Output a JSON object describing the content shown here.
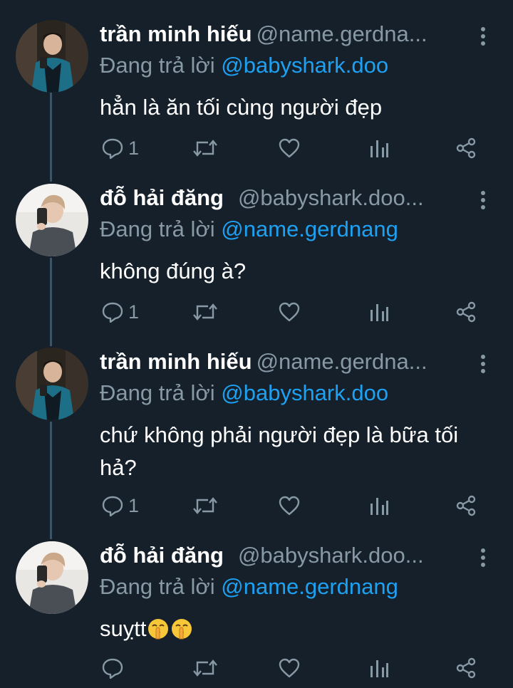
{
  "tweets": [
    {
      "name": "trần minh hiếu",
      "handle": "@name.gerdna...",
      "reply_prefix": "Đang trả lời",
      "reply_to": "@babyshark.doo",
      "text": "hẳn là ăn tối cùng người đẹp",
      "reply_count": "1",
      "avatar": "person-in-blue-jacket-avatar"
    },
    {
      "name": "đỗ hải đăng",
      "handle": "@babyshark.doo...",
      "reply_prefix": "Đang trả lời",
      "reply_to": "@name.gerdnang",
      "text": "không đúng à?",
      "reply_count": "1",
      "avatar": "mirror-selfie-avatar"
    },
    {
      "name": "trần minh hiếu",
      "handle": "@name.gerdna...",
      "reply_prefix": "Đang trả lời",
      "reply_to": "@babyshark.doo",
      "text": "chứ không phải người đẹp là bữa tối hả?",
      "reply_count": "1",
      "avatar": "person-in-blue-jacket-avatar"
    },
    {
      "name": "đỗ hải đăng",
      "handle": "@babyshark.doo...",
      "reply_prefix": "Đang trả lời",
      "reply_to": "@name.gerdnang",
      "text": "suỵtt",
      "emojis": [
        "shushing-face",
        "shushing-face"
      ],
      "reply_count": "",
      "avatar": "mirror-selfie-avatar"
    }
  ],
  "icons": [
    "reply-icon",
    "retweet-icon",
    "like-icon",
    "analytics-icon",
    "share-icon",
    "more-options-icon"
  ],
  "colors": {
    "background": "#15202b",
    "text": "#ffffff",
    "muted": "#8899a6",
    "link": "#1da1f2",
    "thread_line": "#3d5466"
  }
}
